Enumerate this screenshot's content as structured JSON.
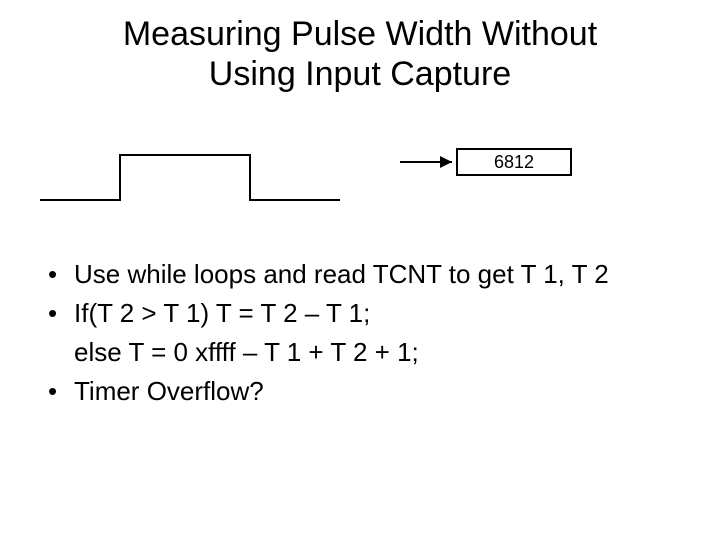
{
  "title_line1": "Measuring Pulse Width Without",
  "title_line2": "Using Input Capture",
  "counter_value": "6812",
  "bullets": {
    "b1": "Use while loops and read TCNT to get T 1, T 2",
    "b2": "If(T 2 > T 1) T = T 2 – T 1;",
    "b2b": "else T = 0 xffff – T 1 + T 2 + 1;",
    "b3": "Timer Overflow?"
  }
}
